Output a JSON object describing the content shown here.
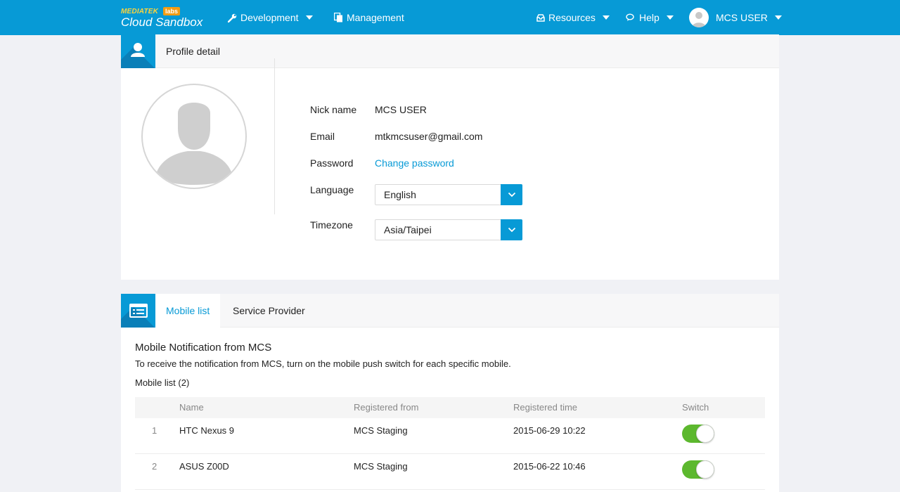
{
  "header": {
    "brand_top": "MEDIATEK",
    "brand_labs": "labs",
    "brand_main": "Cloud Sandbox",
    "nav": {
      "development": "Development",
      "management": "Management",
      "resources": "Resources",
      "help": "Help",
      "user": "MCS USER"
    }
  },
  "profile": {
    "title": "Profile detail",
    "fields": {
      "nickname_label": "Nick name",
      "nickname_value": "MCS USER",
      "email_label": "Email",
      "email_value": "mtkmcsuser@gmail.com",
      "password_label": "Password",
      "password_link": "Change password",
      "language_label": "Language",
      "language_value": "English",
      "timezone_label": "Timezone",
      "timezone_value": "Asia/Taipei"
    }
  },
  "mobile": {
    "tabs": [
      "Mobile list",
      "Service Provider"
    ],
    "active_tab": "Mobile list",
    "section_title": "Mobile Notification from MCS",
    "section_desc": "To receive the notification from MCS, turn on the mobile push switch for each specific mobile.",
    "list_count": "Mobile list (2)",
    "columns": [
      "Name",
      "Registered from",
      "Registered time",
      "Switch"
    ],
    "rows": [
      {
        "index": "1",
        "name": "HTC Nexus 9",
        "registered_from": "MCS Staging",
        "registered_time": "2015-06-29 10:22",
        "switch_on": true
      },
      {
        "index": "2",
        "name": "ASUS Z00D",
        "registered_from": "MCS Staging",
        "registered_time": "2015-06-22 10:46",
        "switch_on": true
      }
    ]
  },
  "colors": {
    "primary": "#079ad6",
    "toggle_on": "#5cb82e",
    "background": "#f0f1f5"
  }
}
